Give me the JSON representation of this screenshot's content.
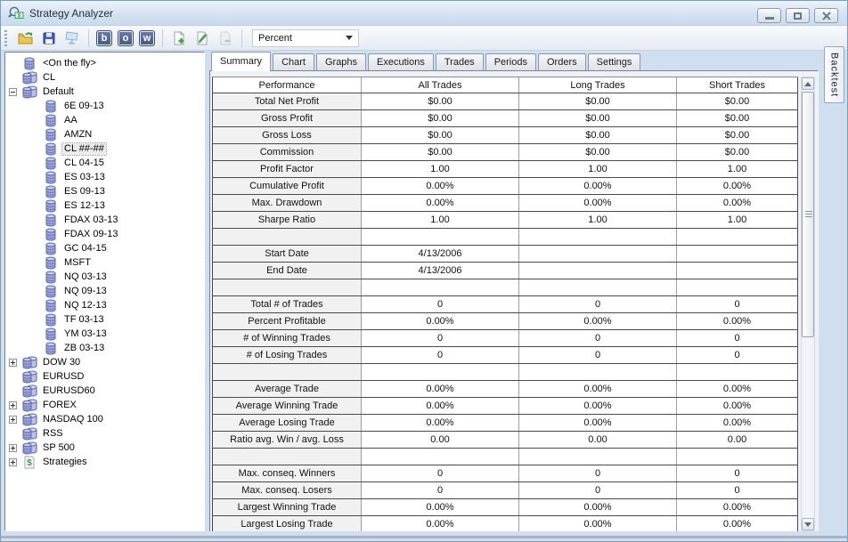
{
  "window": {
    "title": "Strategy Analyzer",
    "controls": {
      "minimize": "minimize",
      "maximize": "maximize",
      "close": "close"
    }
  },
  "icons": {
    "app": "magnifier-dollar-icon",
    "open": "open-folder-icon",
    "save": "floppy-disk-icon",
    "display": "monitor-icon",
    "add": "add-document-icon",
    "edit": "pencil-document-icon",
    "remove": "remove-document-icon",
    "combo_arrow": "chevron-down-icon",
    "tree_single": "database-icon",
    "tree_group": "database-group-icon",
    "tree_strategy": "strategy-document-icon"
  },
  "toolbar": {
    "letter_buttons": [
      {
        "label": "b"
      },
      {
        "label": "o"
      },
      {
        "label": "w"
      }
    ],
    "display_mode": {
      "value": "Percent"
    }
  },
  "sidebar": {
    "items": [
      {
        "label": "<On the fly>",
        "level": 1,
        "icon": "database-icon",
        "expand": null,
        "selected": false
      },
      {
        "label": "CL",
        "level": 1,
        "icon": "database-group-icon",
        "expand": null,
        "selected": false
      },
      {
        "label": "Default",
        "level": 1,
        "icon": "database-group-icon",
        "expand": "minus",
        "selected": false
      },
      {
        "label": "6E 09-13",
        "level": 2,
        "icon": "database-icon",
        "expand": null,
        "selected": false
      },
      {
        "label": "AA",
        "level": 2,
        "icon": "database-icon",
        "expand": null,
        "selected": false
      },
      {
        "label": "AMZN",
        "level": 2,
        "icon": "database-icon",
        "expand": null,
        "selected": false
      },
      {
        "label": "CL ##-##",
        "level": 2,
        "icon": "database-icon",
        "expand": null,
        "selected": true
      },
      {
        "label": "CL 04-15",
        "level": 2,
        "icon": "database-icon",
        "expand": null,
        "selected": false
      },
      {
        "label": "ES 03-13",
        "level": 2,
        "icon": "database-icon",
        "expand": null,
        "selected": false
      },
      {
        "label": "ES 09-13",
        "level": 2,
        "icon": "database-icon",
        "expand": null,
        "selected": false
      },
      {
        "label": "ES 12-13",
        "level": 2,
        "icon": "database-icon",
        "expand": null,
        "selected": false
      },
      {
        "label": "FDAX 03-13",
        "level": 2,
        "icon": "database-icon",
        "expand": null,
        "selected": false
      },
      {
        "label": "FDAX 09-13",
        "level": 2,
        "icon": "database-icon",
        "expand": null,
        "selected": false
      },
      {
        "label": "GC 04-15",
        "level": 2,
        "icon": "database-icon",
        "expand": null,
        "selected": false
      },
      {
        "label": "MSFT",
        "level": 2,
        "icon": "database-icon",
        "expand": null,
        "selected": false
      },
      {
        "label": "NQ 03-13",
        "level": 2,
        "icon": "database-icon",
        "expand": null,
        "selected": false
      },
      {
        "label": "NQ 09-13",
        "level": 2,
        "icon": "database-icon",
        "expand": null,
        "selected": false
      },
      {
        "label": "NQ 12-13",
        "level": 2,
        "icon": "database-icon",
        "expand": null,
        "selected": false
      },
      {
        "label": "TF 03-13",
        "level": 2,
        "icon": "database-icon",
        "expand": null,
        "selected": false
      },
      {
        "label": "YM 03-13",
        "level": 2,
        "icon": "database-icon",
        "expand": null,
        "selected": false
      },
      {
        "label": "ZB 03-13",
        "level": 2,
        "icon": "database-icon",
        "expand": null,
        "selected": false
      },
      {
        "label": "DOW 30",
        "level": 1,
        "icon": "database-group-icon",
        "expand": "plus",
        "selected": false
      },
      {
        "label": "EURUSD",
        "level": 1,
        "icon": "database-group-icon",
        "expand": null,
        "selected": false
      },
      {
        "label": "EURUSD60",
        "level": 1,
        "icon": "database-group-icon",
        "expand": null,
        "selected": false
      },
      {
        "label": "FOREX",
        "level": 1,
        "icon": "database-group-icon",
        "expand": "plus",
        "selected": false
      },
      {
        "label": "NASDAQ 100",
        "level": 1,
        "icon": "database-group-icon",
        "expand": "plus",
        "selected": false
      },
      {
        "label": "RSS",
        "level": 1,
        "icon": "database-group-icon",
        "expand": null,
        "selected": false
      },
      {
        "label": "SP 500",
        "level": 1,
        "icon": "database-group-icon",
        "expand": "plus",
        "selected": false
      },
      {
        "label": "Strategies",
        "level": 1,
        "icon": "strategy-document-icon",
        "expand": "plus",
        "selected": false
      }
    ]
  },
  "tabs": {
    "active": "Summary",
    "items": [
      "Summary",
      "Chart",
      "Graphs",
      "Executions",
      "Trades",
      "Periods",
      "Orders",
      "Settings"
    ]
  },
  "backtest_tab": {
    "label": "Backtest"
  },
  "summary_table": {
    "columns": [
      "Performance",
      "All Trades",
      "Long Trades",
      "Short Trades"
    ],
    "rows": [
      {
        "label": "Total Net Profit",
        "all": "$0.00",
        "long": "$0.00",
        "short": "$0.00"
      },
      {
        "label": "Gross Profit",
        "all": "$0.00",
        "long": "$0.00",
        "short": "$0.00"
      },
      {
        "label": "Gross Loss",
        "all": "$0.00",
        "long": "$0.00",
        "short": "$0.00"
      },
      {
        "label": "Commission",
        "all": "$0.00",
        "long": "$0.00",
        "short": "$0.00"
      },
      {
        "label": "Profit Factor",
        "all": "1.00",
        "long": "1.00",
        "short": "1.00"
      },
      {
        "label": "Cumulative Profit",
        "all": "0.00%",
        "long": "0.00%",
        "short": "0.00%"
      },
      {
        "label": "Max. Drawdown",
        "all": "0.00%",
        "long": "0.00%",
        "short": "0.00%"
      },
      {
        "label": "Sharpe Ratio",
        "all": "1.00",
        "long": "1.00",
        "short": "1.00"
      },
      {
        "label": "",
        "all": "",
        "long": "",
        "short": ""
      },
      {
        "label": "Start Date",
        "all": "4/13/2006",
        "long": "",
        "short": ""
      },
      {
        "label": "End Date",
        "all": "4/13/2006",
        "long": "",
        "short": ""
      },
      {
        "label": "",
        "all": "",
        "long": "",
        "short": ""
      },
      {
        "label": "Total # of Trades",
        "all": "0",
        "long": "0",
        "short": "0"
      },
      {
        "label": "Percent Profitable",
        "all": "0.00%",
        "long": "0.00%",
        "short": "0.00%"
      },
      {
        "label": "# of Winning Trades",
        "all": "0",
        "long": "0",
        "short": "0"
      },
      {
        "label": "# of Losing Trades",
        "all": "0",
        "long": "0",
        "short": "0"
      },
      {
        "label": "",
        "all": "",
        "long": "",
        "short": ""
      },
      {
        "label": "Average Trade",
        "all": "0.00%",
        "long": "0.00%",
        "short": "0.00%"
      },
      {
        "label": "Average Winning Trade",
        "all": "0.00%",
        "long": "0.00%",
        "short": "0.00%"
      },
      {
        "label": "Average Losing Trade",
        "all": "0.00%",
        "long": "0.00%",
        "short": "0.00%"
      },
      {
        "label": "Ratio avg. Win / avg. Loss",
        "all": "0.00",
        "long": "0.00",
        "short": "0.00"
      },
      {
        "label": "",
        "all": "",
        "long": "",
        "short": ""
      },
      {
        "label": "Max. conseq. Winners",
        "all": "0",
        "long": "0",
        "short": "0"
      },
      {
        "label": "Max. conseq. Losers",
        "all": "0",
        "long": "0",
        "short": "0"
      },
      {
        "label": "Largest Winning Trade",
        "all": "0.00%",
        "long": "0.00%",
        "short": "0.00%"
      },
      {
        "label": "Largest Losing Trade",
        "all": "0.00%",
        "long": "0.00%",
        "short": "0.00%"
      }
    ]
  }
}
